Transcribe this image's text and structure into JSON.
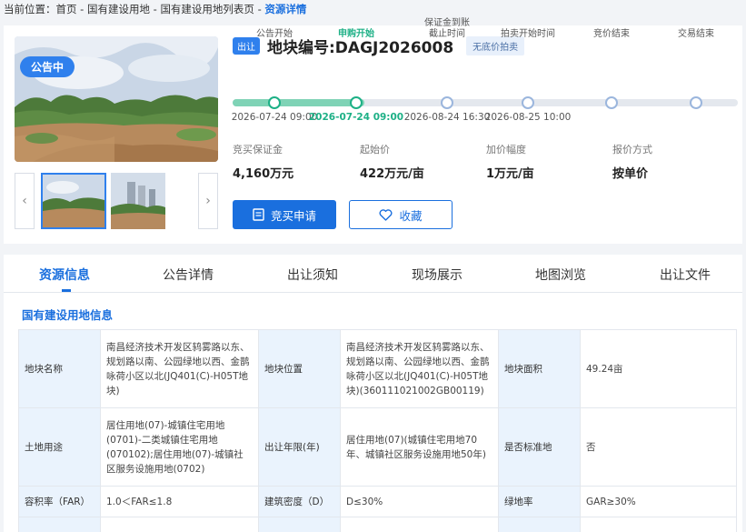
{
  "breadcrumb": {
    "prefix": "当前位置：",
    "items": [
      "首页",
      "国有建设用地",
      "国有建设用地列表页"
    ],
    "separator": " - ",
    "current": "资源详情"
  },
  "gallery": {
    "status_badge": "公告中",
    "prev_icon": "chevron-left-icon",
    "next_icon": "chevron-right-icon",
    "colors": {
      "badge": "#2f80ed",
      "selected_border": "#2f80ed"
    }
  },
  "header": {
    "type_tag": "出让",
    "title": "地块编号:DAGJ2026008",
    "auction_tag": "无底价拍卖"
  },
  "timeline": {
    "steps": [
      {
        "label": "公告开始",
        "date": "2026-07-24 09:00",
        "state": "done"
      },
      {
        "label": "申购开始",
        "date": "2026-07-24 09:00",
        "state": "active"
      },
      {
        "label": "保证金到账\n截止时间",
        "date": "2026-08-24 16:30",
        "state": "pending"
      },
      {
        "label": "拍卖开始时间",
        "date": "2026-08-25 10:00",
        "state": "pending"
      },
      {
        "label": "竞价结束",
        "date": "",
        "state": "pending"
      },
      {
        "label": "交易结束",
        "date": "",
        "state": "pending"
      }
    ],
    "progress": 0.26,
    "colors": {
      "active": "#1db086",
      "fill": "#7fd3b6",
      "track": "#e4e8ee",
      "pending_dot": "#9bb6dd"
    }
  },
  "stats": [
    {
      "label": "竞买保证金",
      "value": "4,160万元"
    },
    {
      "label": "起始价",
      "value": "422万元/亩"
    },
    {
      "label": "加价幅度",
      "value": "1万元/亩"
    },
    {
      "label": "报价方式",
      "value": "按单价"
    }
  ],
  "actions": {
    "apply": {
      "label": "竞买申请",
      "icon": "document-icon"
    },
    "favorite": {
      "label": "收藏",
      "icon": "heart-icon"
    },
    "colors": {
      "primary": "#1a6fde"
    }
  },
  "tabs": [
    {
      "label": "资源信息",
      "active": true
    },
    {
      "label": "公告详情",
      "active": false
    },
    {
      "label": "出让须知",
      "active": false
    },
    {
      "label": "现场展示",
      "active": false
    },
    {
      "label": "地图浏览",
      "active": false
    },
    {
      "label": "出让文件",
      "active": false
    }
  ],
  "land_info": {
    "section_title": "国有建设用地信息",
    "rows": [
      [
        {
          "k": "地块名称",
          "v": "南昌经济技术开发区鸫雾路以东、规划路以南、公园绿地以西、金鹊咏荷小区以北(JQ401(C)-H05T地块)"
        },
        {
          "k": "地块位置",
          "v": "南昌经济技术开发区鸫雾路以东、规划路以南、公园绿地以西、金鹊咏荷小区以北(JQ401(C)-H05T地块)(360111021002GB00119)"
        },
        {
          "k": "地块面积",
          "v": "49.24亩"
        }
      ],
      [
        {
          "k": "土地用途",
          "v": "居住用地(07)-城镇住宅用地(0701)-二类城镇住宅用地(070102);居住用地(07)-城镇社区服务设施用地(0702)"
        },
        {
          "k": "出让年限(年)",
          "v": "居住用地(07)(城镇住宅用地70年、城镇社区服务设施用地50年)"
        },
        {
          "k": "是否标准地",
          "v": "否"
        }
      ],
      [
        {
          "k": "容积率（FAR）",
          "v": "1.0＜FAR≤1.8"
        },
        {
          "k": "建筑密度（D）",
          "v": "D≤30%"
        },
        {
          "k": "绿地率",
          "v": "GAR≥30%"
        }
      ],
      [
        {
          "k": "",
          "v": ""
        },
        {
          "k": "",
          "v": ""
        },
        {
          "k": "",
          "v": ""
        }
      ]
    ]
  }
}
